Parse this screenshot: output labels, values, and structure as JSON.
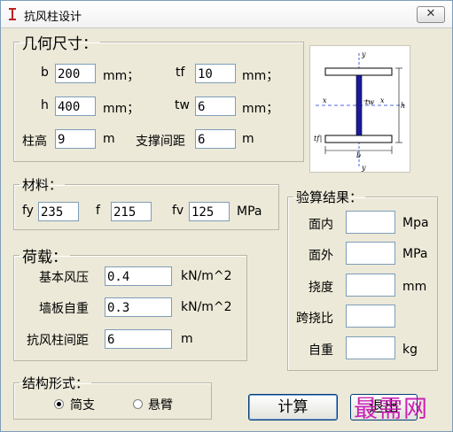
{
  "window": {
    "title": "抗风柱设计",
    "close_symbol": "✕"
  },
  "geometry": {
    "legend": "几何尺寸：",
    "b": {
      "label": "b",
      "value": "200",
      "unit": "mm；"
    },
    "tf": {
      "label": "tf",
      "value": "10",
      "unit": "mm；"
    },
    "h": {
      "label": "h",
      "value": "400",
      "unit": "mm；"
    },
    "tw": {
      "label": "tw",
      "value": "6",
      "unit": "mm；"
    },
    "col_height": {
      "label": "柱高",
      "value": "9",
      "unit": "m"
    },
    "brace_spacing": {
      "label": "支撑间距",
      "value": "6",
      "unit": "m"
    }
  },
  "material": {
    "legend": "材料：",
    "fy": {
      "label": "fy",
      "value": "235"
    },
    "f": {
      "label": "f",
      "value": "215"
    },
    "fv": {
      "label": "fv",
      "value": "125"
    },
    "unit": "MPa"
  },
  "load": {
    "legend": "荷载：",
    "wind": {
      "label": "基本风压",
      "value": "0.4",
      "unit": "kN/m^2"
    },
    "wall": {
      "label": "墙板自重",
      "value": "0.3",
      "unit": "kN/m^2"
    },
    "spacing": {
      "label": "抗风柱间距",
      "value": "6",
      "unit": "m"
    }
  },
  "results": {
    "legend": "验算结果：",
    "in_plane": {
      "label": "面内",
      "unit": "Mpa"
    },
    "out_plane": {
      "label": "面外",
      "unit": "MPa"
    },
    "deflection": {
      "label": "挠度",
      "unit": "mm"
    },
    "span_ratio": {
      "label": "跨挠比",
      "unit": ""
    },
    "self_weight": {
      "label": "自重",
      "unit": "kg"
    }
  },
  "structure": {
    "legend": "结构形式：",
    "options": [
      {
        "label": "简支",
        "selected": true
      },
      {
        "label": "悬臂",
        "selected": false
      }
    ]
  },
  "buttons": {
    "calc": "计算",
    "exit": "退出"
  },
  "watermark": "最需网",
  "diagram_labels": {
    "y_top": "y",
    "y_bottom": "y",
    "x_left": "x",
    "x_right": "x",
    "tw": "tw",
    "tf": "tf",
    "h": "h",
    "b": "b"
  },
  "colors": {
    "web": "#1a1aa0",
    "axis": "#1e3ad6",
    "watermark": "#c70fb0"
  }
}
